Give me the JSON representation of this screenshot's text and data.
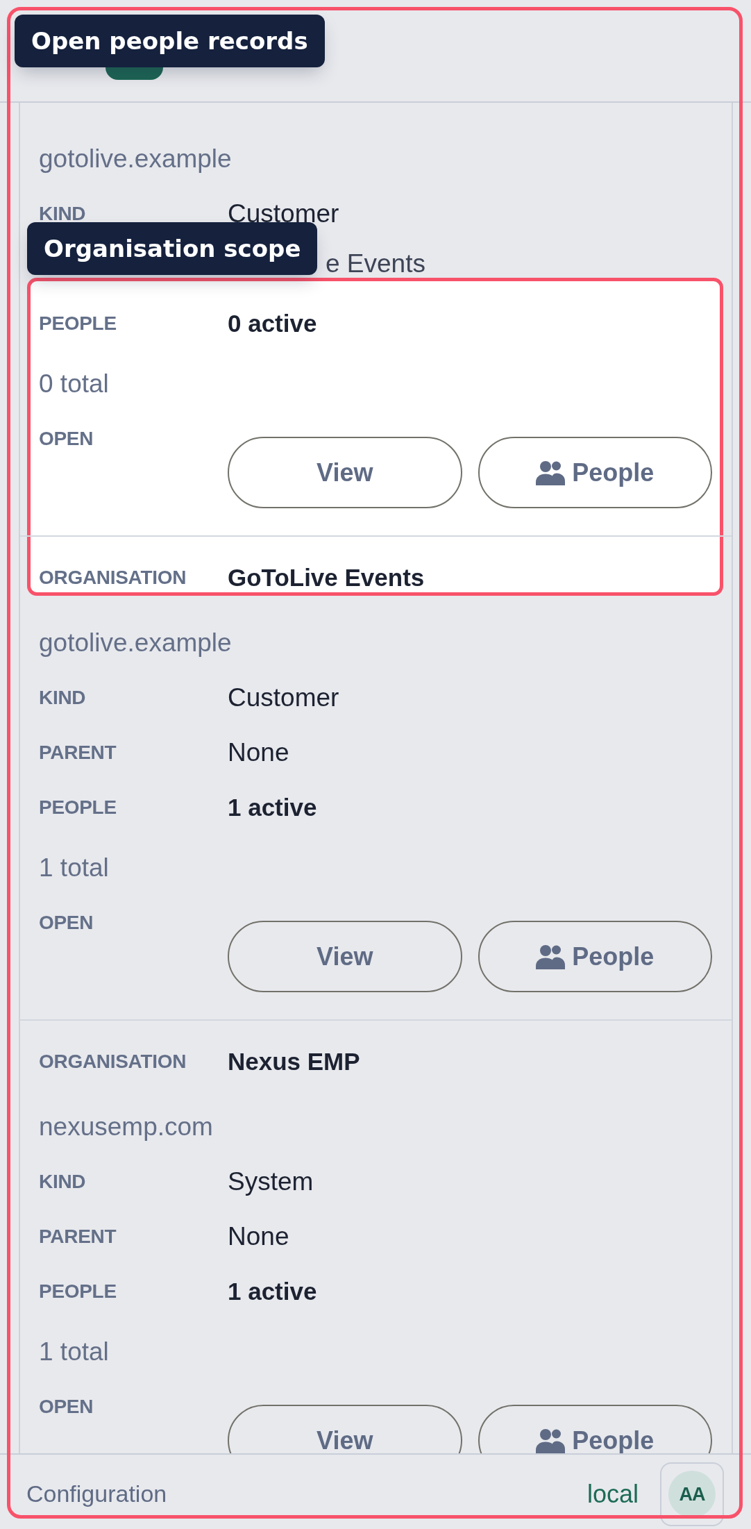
{
  "organisations": [
    {
      "rows": [
        {
          "kind": "note",
          "text": "gotolive.example"
        },
        {
          "kind": "field",
          "label": "KIND",
          "value": "Customer",
          "bold": false
        },
        {
          "kind": "covered",
          "value": "e Events"
        },
        {
          "kind": "field",
          "label": "PEOPLE",
          "value": "0 active",
          "bold": true
        },
        {
          "kind": "note",
          "text": "0 total"
        },
        {
          "kind": "actions",
          "label": "OPEN",
          "buttons": [
            {
              "kind": "plain",
              "label": "View"
            },
            {
              "kind": "iconic",
              "label": "People"
            }
          ]
        }
      ]
    },
    {
      "rows": [
        {
          "kind": "field",
          "label": "ORGANISATION",
          "value": "GoToLive Events",
          "bold": true
        },
        {
          "kind": "note",
          "text": "gotolive.example"
        },
        {
          "kind": "field",
          "label": "KIND",
          "value": "Customer",
          "bold": false
        },
        {
          "kind": "field",
          "label": "PARENT",
          "value": "None",
          "bold": false
        },
        {
          "kind": "field",
          "label": "PEOPLE",
          "value": "1 active",
          "bold": true
        },
        {
          "kind": "note",
          "text": "1 total"
        },
        {
          "kind": "actions",
          "label": "OPEN",
          "buttons": [
            {
              "kind": "plain",
              "label": "View"
            },
            {
              "kind": "iconic",
              "label": "People"
            }
          ]
        }
      ]
    },
    {
      "rows": [
        {
          "kind": "field",
          "label": "ORGANISATION",
          "value": "Nexus EMP",
          "bold": true
        },
        {
          "kind": "note",
          "text": "nexusemp.com"
        },
        {
          "kind": "field",
          "label": "KIND",
          "value": "System",
          "bold": false
        },
        {
          "kind": "field",
          "label": "PARENT",
          "value": "None",
          "bold": false
        },
        {
          "kind": "field",
          "label": "PEOPLE",
          "value": "1 active",
          "bold": true
        },
        {
          "kind": "note",
          "text": "1 total"
        },
        {
          "kind": "actions",
          "label": "OPEN",
          "buttons": [
            {
              "kind": "plain",
              "label": "View"
            },
            {
              "kind": "iconic",
              "label": "People"
            }
          ]
        }
      ]
    }
  ],
  "footer": {
    "title": "Configuration",
    "environment": "local",
    "avatar": "AA"
  },
  "tour": [
    {
      "text": "Open people records"
    },
    {
      "text": "Organisation scope"
    }
  ]
}
